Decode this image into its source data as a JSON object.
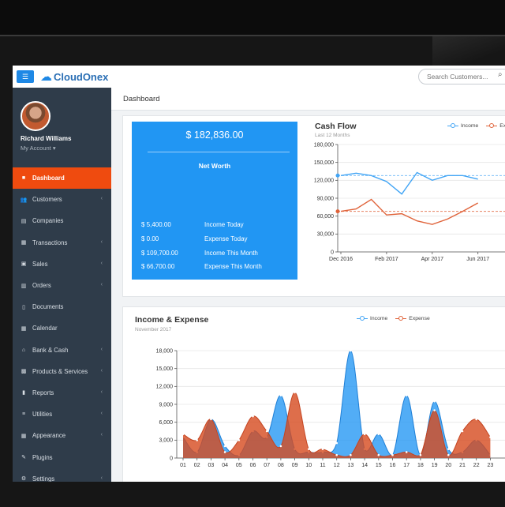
{
  "app": {
    "brand": "CloudOnex"
  },
  "search": {
    "placeholder": "Search Customers..."
  },
  "user": {
    "name": "Richard Williams",
    "account_label": "My Account ▾"
  },
  "sidebar": {
    "items": [
      {
        "label": "Dashboard",
        "icon": "dashboard-icon",
        "glyph": "■",
        "active": true,
        "chevron": false
      },
      {
        "label": "Customers",
        "icon": "users-icon",
        "glyph": "👥",
        "active": false,
        "chevron": true
      },
      {
        "label": "Companies",
        "icon": "building-icon",
        "glyph": "▤",
        "active": false,
        "chevron": false
      },
      {
        "label": "Transactions",
        "icon": "transactions-icon",
        "glyph": "▦",
        "active": false,
        "chevron": true
      },
      {
        "label": "Sales",
        "icon": "sales-icon",
        "glyph": "▣",
        "active": false,
        "chevron": true
      },
      {
        "label": "Orders",
        "icon": "orders-icon",
        "glyph": "▥",
        "active": false,
        "chevron": true
      },
      {
        "label": "Documents",
        "icon": "document-icon",
        "glyph": "▯",
        "active": false,
        "chevron": false
      },
      {
        "label": "Calendar",
        "icon": "calendar-icon",
        "glyph": "▦",
        "active": false,
        "chevron": false
      },
      {
        "label": "Bank & Cash",
        "icon": "bank-icon",
        "glyph": "⌂",
        "active": false,
        "chevron": true
      },
      {
        "label": "Products & Services",
        "icon": "products-icon",
        "glyph": "▩",
        "active": false,
        "chevron": true
      },
      {
        "label": "Reports",
        "icon": "reports-icon",
        "glyph": "▮",
        "active": false,
        "chevron": true
      },
      {
        "label": "Utilities",
        "icon": "utilities-icon",
        "glyph": "≡",
        "active": false,
        "chevron": true
      },
      {
        "label": "Appearance",
        "icon": "appearance-icon",
        "glyph": "▦",
        "active": false,
        "chevron": true
      },
      {
        "label": "Plugins",
        "icon": "plugin-icon",
        "glyph": "✎",
        "active": false,
        "chevron": false
      },
      {
        "label": "Settings",
        "icon": "gear-icon",
        "glyph": "⚙",
        "active": false,
        "chevron": true
      }
    ]
  },
  "page": {
    "title": "Dashboard"
  },
  "net_worth": {
    "amount": "$ 182,836.00",
    "label": "Net Worth",
    "rows": [
      {
        "value": "$ 5,400.00",
        "label": "Income Today"
      },
      {
        "value": "$ 0.00",
        "label": "Expense Today"
      },
      {
        "value": "$ 109,700.00",
        "label": "Income This Month"
      },
      {
        "value": "$ 66,700.00",
        "label": "Expense This Month"
      }
    ]
  },
  "colors": {
    "accent": "#ef4b0f",
    "primary": "#2196f3",
    "sidebar": "#2f3c4a",
    "income": "#42a5f5",
    "expense": "#e0633a"
  },
  "chart_data": [
    {
      "type": "line",
      "title": "Cash Flow",
      "subtitle": "Last 12 Months",
      "legend": [
        "Income",
        "Ex"
      ],
      "x_tick_labels": [
        "Dec 2016",
        "Feb 2017",
        "Apr 2017",
        "Jun 2017"
      ],
      "ylim": [
        0,
        180000
      ],
      "y_ticks": [
        "0",
        "30,000",
        "60,000",
        "90,000",
        "120,000",
        "150,000",
        "180,000"
      ],
      "series": [
        {
          "name": "Income",
          "values": [
            128000,
            132000,
            128000,
            118000,
            97000,
            133000,
            120000,
            128000,
            128000,
            122000
          ]
        },
        {
          "name": "Ex",
          "values": [
            68000,
            72000,
            88000,
            62000,
            64000,
            52000,
            46000,
            55000,
            68000,
            82000
          ]
        }
      ],
      "averages": [
        128000,
        68000
      ]
    },
    {
      "type": "area",
      "title": "Income & Expense",
      "subtitle": "November 2017",
      "legend": [
        "Income",
        "Expense"
      ],
      "categories": [
        "01",
        "02",
        "03",
        "04",
        "05",
        "06",
        "07",
        "08",
        "09",
        "10",
        "11",
        "12",
        "13",
        "14",
        "15",
        "16",
        "17",
        "18",
        "19",
        "20",
        "21",
        "22",
        "23"
      ],
      "ylim": [
        0,
        18000
      ],
      "y_ticks": [
        "0",
        "3,000",
        "6,000",
        "9,000",
        "12,000",
        "15,000",
        "18,000"
      ],
      "series": [
        {
          "name": "Income",
          "values": [
            3500,
            1000,
            6500,
            2000,
            500,
            4500,
            3500,
            10500,
            1500,
            1000,
            1000,
            2500,
            18000,
            1500,
            4000,
            500,
            10500,
            500,
            9500,
            1500,
            1000,
            3000,
            500
          ]
        },
        {
          "name": "Expense",
          "values": [
            4000,
            3000,
            6500,
            1000,
            3000,
            7000,
            4500,
            2000,
            11000,
            1500,
            1500,
            500,
            500,
            4000,
            500,
            500,
            1000,
            500,
            8000,
            500,
            4500,
            6500,
            3500
          ]
        }
      ]
    }
  ]
}
